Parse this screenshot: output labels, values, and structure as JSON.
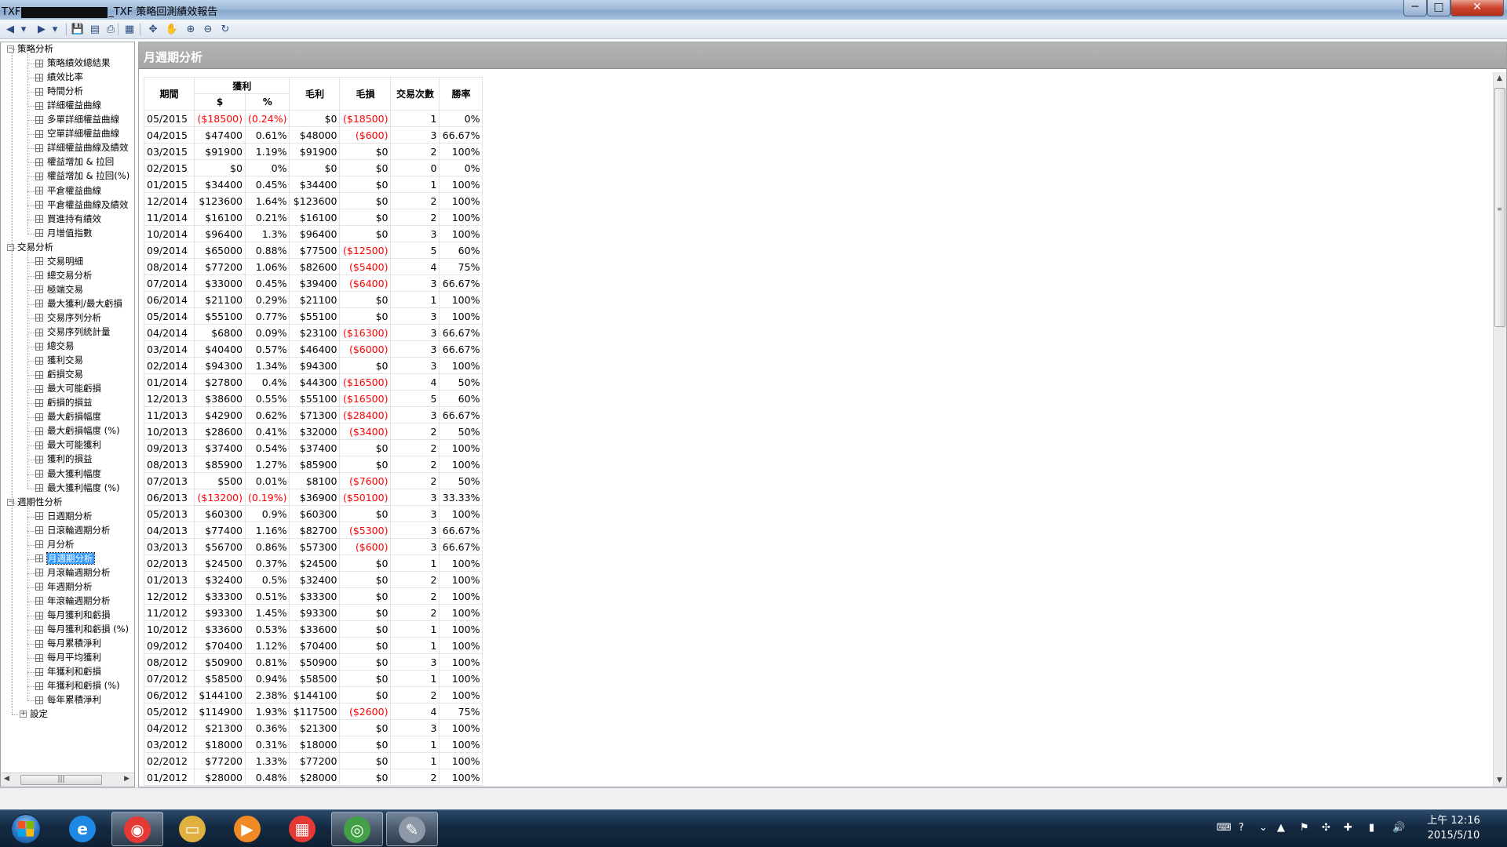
{
  "window": {
    "title_prefix": "TXF",
    "title_suffix": "_TXF 策略回測績效報告",
    "min_glyph": "─",
    "max_glyph": "□",
    "close_glyph": "✕"
  },
  "toolbar": {
    "icons": [
      "back-arrow-icon",
      "dropdown-icon",
      "forward-arrow-icon",
      "dropdown-icon",
      "save-icon",
      "export-icon",
      "print-icon",
      "layout-icon",
      "pointer-icon",
      "pan-hand-icon",
      "zoom-in-icon",
      "zoom-out-icon",
      "refresh-icon"
    ],
    "glyphs": [
      "◀",
      "▾",
      "▶",
      "▾",
      "💾",
      "▤",
      "⎙",
      "▦",
      "✥",
      "✋",
      "⊕",
      "⊖",
      "↻"
    ]
  },
  "tree": {
    "expand_glyph": "−",
    "leaf_glyph": "+",
    "groups": [
      {
        "label": "策略分析",
        "items": [
          "策略績效總結果",
          "績效比率",
          "時間分析",
          "詳細權益曲線",
          "多單詳細權益曲線",
          "空單詳細權益曲線",
          "詳細權益曲線及績效",
          "權益增加 & 拉回",
          "權益增加 & 拉回(%)",
          "平倉權益曲線",
          "平倉權益曲線及績效",
          "買進持有績效",
          "月增值指數"
        ]
      },
      {
        "label": "交易分析",
        "items": [
          "交易明細",
          "總交易分析",
          "極端交易",
          "最大獲利/最大虧損",
          "交易序列分析",
          "交易序列統計量",
          "總交易",
          "獲利交易",
          "虧損交易",
          "最大可能虧損",
          "虧損的損益",
          "最大虧損幅度",
          "最大虧損幅度 (%)",
          "最大可能獲利",
          "獲利的損益",
          "最大獲利幅度",
          "最大獲利幅度 (%)"
        ]
      },
      {
        "label": "週期性分析",
        "items": [
          "日週期分析",
          "日滾輪週期分析",
          "月分析",
          "月週期分析",
          "月滾輪週期分析",
          "年週期分析",
          "年滾輪週期分析",
          "每月獲利和虧損",
          "每月獲利和虧損 (%)",
          "每月累積淨利",
          "每月平均獲利",
          "年獲利和虧損",
          "年獲利和虧損 (%)",
          "每年累積淨利"
        ]
      }
    ],
    "settings_label": "設定",
    "selected": "月週期分析",
    "hscroll_grip": "|||",
    "left_arrow": "◀",
    "right_arrow": "▶"
  },
  "main": {
    "header_title": "月週期分析",
    "scroll_up": "▲",
    "scroll_down": "▼",
    "scroll_grip": "≡",
    "columns": {
      "period": "期間",
      "profit": "獲利",
      "profit_dollar": "$",
      "profit_pct": "%",
      "gross_profit": "毛利",
      "gross_loss": "毛損",
      "trades": "交易次數",
      "win_rate": "勝率"
    },
    "rows": [
      [
        "05/2015",
        "($18500)",
        "(0.24%)",
        "$0",
        "($18500)",
        "1",
        "0%"
      ],
      [
        "04/2015",
        "$47400",
        "0.61%",
        "$48000",
        "($600)",
        "3",
        "66.67%"
      ],
      [
        "03/2015",
        "$91900",
        "1.19%",
        "$91900",
        "$0",
        "2",
        "100%"
      ],
      [
        "02/2015",
        "$0",
        "0%",
        "$0",
        "$0",
        "0",
        "0%"
      ],
      [
        "01/2015",
        "$34400",
        "0.45%",
        "$34400",
        "$0",
        "1",
        "100%"
      ],
      [
        "12/2014",
        "$123600",
        "1.64%",
        "$123600",
        "$0",
        "2",
        "100%"
      ],
      [
        "11/2014",
        "$16100",
        "0.21%",
        "$16100",
        "$0",
        "2",
        "100%"
      ],
      [
        "10/2014",
        "$96400",
        "1.3%",
        "$96400",
        "$0",
        "3",
        "100%"
      ],
      [
        "09/2014",
        "$65000",
        "0.88%",
        "$77500",
        "($12500)",
        "5",
        "60%"
      ],
      [
        "08/2014",
        "$77200",
        "1.06%",
        "$82600",
        "($5400)",
        "4",
        "75%"
      ],
      [
        "07/2014",
        "$33000",
        "0.45%",
        "$39400",
        "($6400)",
        "3",
        "66.67%"
      ],
      [
        "06/2014",
        "$21100",
        "0.29%",
        "$21100",
        "$0",
        "1",
        "100%"
      ],
      [
        "05/2014",
        "$55100",
        "0.77%",
        "$55100",
        "$0",
        "3",
        "100%"
      ],
      [
        "04/2014",
        "$6800",
        "0.09%",
        "$23100",
        "($16300)",
        "3",
        "66.67%"
      ],
      [
        "03/2014",
        "$40400",
        "0.57%",
        "$46400",
        "($6000)",
        "3",
        "66.67%"
      ],
      [
        "02/2014",
        "$94300",
        "1.34%",
        "$94300",
        "$0",
        "3",
        "100%"
      ],
      [
        "01/2014",
        "$27800",
        "0.4%",
        "$44300",
        "($16500)",
        "4",
        "50%"
      ],
      [
        "12/2013",
        "$38600",
        "0.55%",
        "$55100",
        "($16500)",
        "5",
        "60%"
      ],
      [
        "11/2013",
        "$42900",
        "0.62%",
        "$71300",
        "($28400)",
        "3",
        "66.67%"
      ],
      [
        "10/2013",
        "$28600",
        "0.41%",
        "$32000",
        "($3400)",
        "2",
        "50%"
      ],
      [
        "09/2013",
        "$37400",
        "0.54%",
        "$37400",
        "$0",
        "2",
        "100%"
      ],
      [
        "08/2013",
        "$85900",
        "1.27%",
        "$85900",
        "$0",
        "2",
        "100%"
      ],
      [
        "07/2013",
        "$500",
        "0.01%",
        "$8100",
        "($7600)",
        "2",
        "50%"
      ],
      [
        "06/2013",
        "($13200)",
        "(0.19%)",
        "$36900",
        "($50100)",
        "3",
        "33.33%"
      ],
      [
        "05/2013",
        "$60300",
        "0.9%",
        "$60300",
        "$0",
        "3",
        "100%"
      ],
      [
        "04/2013",
        "$77400",
        "1.16%",
        "$82700",
        "($5300)",
        "3",
        "66.67%"
      ],
      [
        "03/2013",
        "$56700",
        "0.86%",
        "$57300",
        "($600)",
        "3",
        "66.67%"
      ],
      [
        "02/2013",
        "$24500",
        "0.37%",
        "$24500",
        "$0",
        "1",
        "100%"
      ],
      [
        "01/2013",
        "$32400",
        "0.5%",
        "$32400",
        "$0",
        "2",
        "100%"
      ],
      [
        "12/2012",
        "$33300",
        "0.51%",
        "$33300",
        "$0",
        "2",
        "100%"
      ],
      [
        "11/2012",
        "$93300",
        "1.45%",
        "$93300",
        "$0",
        "2",
        "100%"
      ],
      [
        "10/2012",
        "$33600",
        "0.53%",
        "$33600",
        "$0",
        "1",
        "100%"
      ],
      [
        "09/2012",
        "$70400",
        "1.12%",
        "$70400",
        "$0",
        "1",
        "100%"
      ],
      [
        "08/2012",
        "$50900",
        "0.81%",
        "$50900",
        "$0",
        "3",
        "100%"
      ],
      [
        "07/2012",
        "$58500",
        "0.94%",
        "$58500",
        "$0",
        "1",
        "100%"
      ],
      [
        "06/2012",
        "$144100",
        "2.38%",
        "$144100",
        "$0",
        "2",
        "100%"
      ],
      [
        "05/2012",
        "$114900",
        "1.93%",
        "$117500",
        "($2600)",
        "4",
        "75%"
      ],
      [
        "04/2012",
        "$21300",
        "0.36%",
        "$21300",
        "$0",
        "3",
        "100%"
      ],
      [
        "03/2012",
        "$18000",
        "0.31%",
        "$18000",
        "$0",
        "1",
        "100%"
      ],
      [
        "02/2012",
        "$77200",
        "1.33%",
        "$77200",
        "$0",
        "1",
        "100%"
      ],
      [
        "01/2012",
        "$28000",
        "0.48%",
        "$28000",
        "$0",
        "2",
        "100%"
      ]
    ]
  },
  "colors": {
    "negative": "#ff0000",
    "selection": "#3399ff",
    "header_bg": "#adadad"
  },
  "taskbar": {
    "apps": [
      {
        "name": "ie-icon",
        "glyph": "e",
        "color": "#1e88e5",
        "active": false
      },
      {
        "name": "chrome-icon",
        "glyph": "◉",
        "color": "#e53935",
        "active": true
      },
      {
        "name": "file-explorer-icon",
        "glyph": "▭",
        "color": "#e0b040",
        "active": false
      },
      {
        "name": "media-player-icon",
        "glyph": "▶",
        "color": "#f08a24",
        "active": false
      },
      {
        "name": "app-grid-icon",
        "glyph": "▦",
        "color": "#e53935",
        "active": false
      },
      {
        "name": "globe-app-icon",
        "glyph": "◎",
        "color": "#43a047",
        "active": true
      },
      {
        "name": "paint-icon",
        "glyph": "✎",
        "color": "#8e99a8",
        "active": true
      }
    ],
    "tray_icons": [
      "keyboard-icon",
      "help-icon",
      "dropdown-icon",
      "show-hidden-icon",
      "flag-icon",
      "dropbox-icon",
      "update-icon",
      "signal-icon",
      "volume-icon"
    ],
    "tray_glyphs": [
      "⌨",
      "?",
      "⌄",
      "▲",
      "⚑",
      "✣",
      "✚",
      "▮",
      "🔊"
    ],
    "time": "上午 12:16",
    "date": "2015/5/10"
  }
}
